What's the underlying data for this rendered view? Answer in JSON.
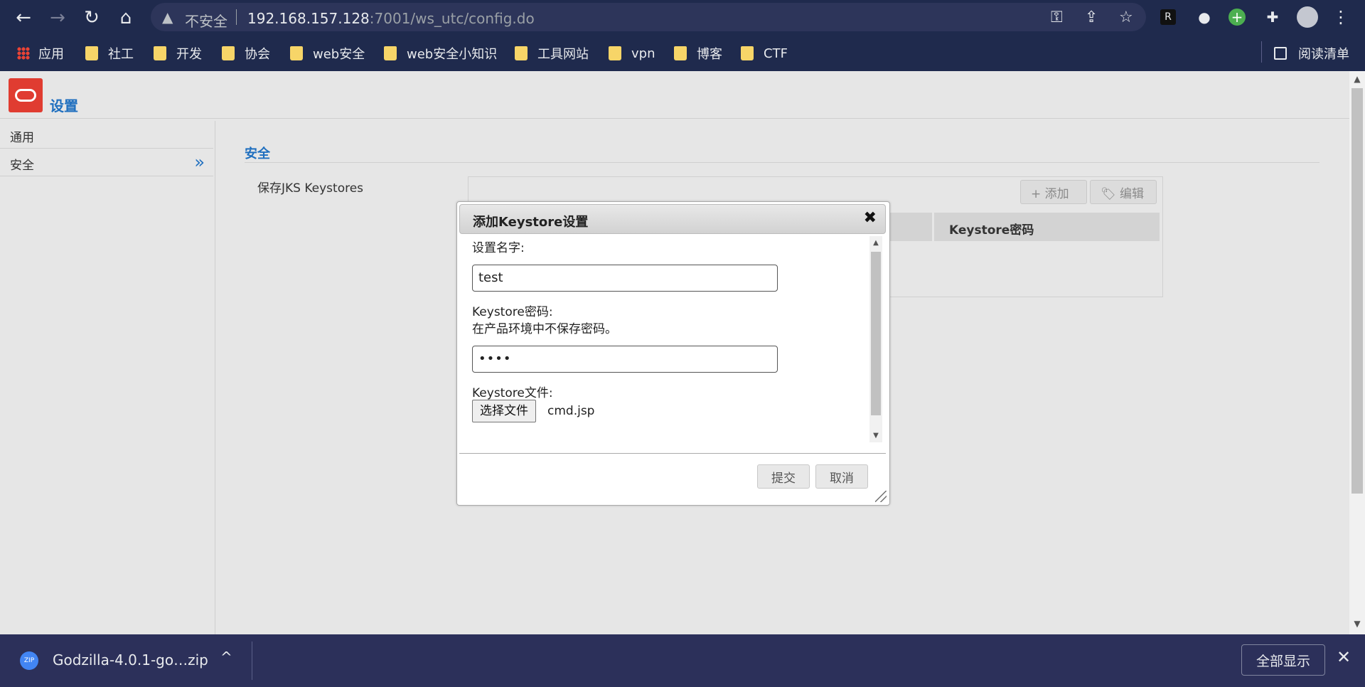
{
  "browser": {
    "back_icon": "←",
    "forward_icon": "→",
    "reload_icon": "↻",
    "home_icon": "⌂",
    "security_icon": "▲",
    "security_label": "不安全",
    "url_host": "192.168.157.128",
    "url_rest": ":7001/ws_utc/config.do",
    "key_icon": "⚿",
    "share_icon": "⇪",
    "star_icon": "☆",
    "ext_icons": [
      "R",
      "●",
      "+",
      "✚"
    ],
    "menu_icon": "⋮"
  },
  "bookmarks": {
    "apps_label": "应用",
    "items": [
      "社工",
      "开发",
      "协会",
      "web安全",
      "web安全小知识",
      "工具网站",
      "vpn",
      "博客",
      "CTF"
    ],
    "reading_list": "阅读清单"
  },
  "app": {
    "title": "设置",
    "sidebar": [
      {
        "label": "通用"
      },
      {
        "label": "安全",
        "chevron": "»"
      }
    ],
    "section_title": "安全",
    "keystore_label": "保存JKS Keystores",
    "toolbar": {
      "add_label": "+ 添加",
      "edit_label": "🏷 编辑"
    },
    "grid_columns": [
      "Keystore密码"
    ]
  },
  "dialog": {
    "title": "添加Keystore设置",
    "close_icon": "✖",
    "name_label": "设置名字:",
    "name_value": "test",
    "password_label": "Keystore密码:",
    "password_hint": "在产品环境中不保存密码。",
    "password_value": "••••",
    "file_label": "Keystore文件:",
    "choose_file_label": "选择文件",
    "file_name": "cmd.jsp",
    "submit_label": "提交",
    "cancel_label": "取消"
  },
  "downloads": {
    "file_name": "Godzilla-4.0.1-go…zip",
    "caret_icon": "^",
    "show_all_label": "全部显示",
    "close_icon": "✕"
  }
}
